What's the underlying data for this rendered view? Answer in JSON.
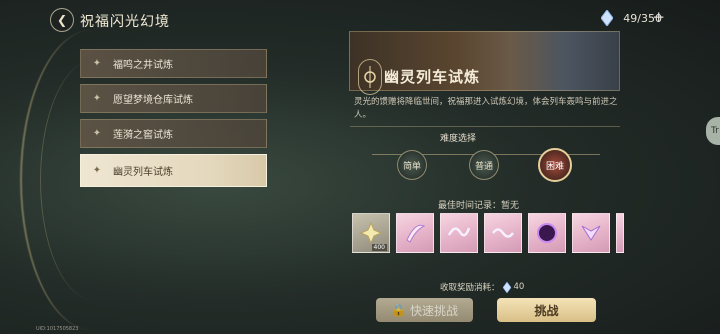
{
  "header": {
    "title": "祝福闪光幻境",
    "currency_value": "49/350",
    "plus": "+"
  },
  "trials": [
    {
      "label": "福鸣之井试炼"
    },
    {
      "label": "愿望梦境仓库试炼"
    },
    {
      "label": "莲漪之窖试炼"
    },
    {
      "label": "幽灵列车试炼",
      "active": true
    }
  ],
  "detail": {
    "title": "幽灵列车试炼",
    "description": "灵光的馈赠将降临世间，祝福那进入试炼幻境，体会列车轰鸣与前进之人。",
    "difficulty_title": "难度选择",
    "difficulties": [
      "简单",
      "普通",
      "困难"
    ],
    "selected_difficulty": "困难",
    "best_time_label": "最佳时间记录：暂无",
    "rewards": [
      {
        "icon": "star-crystal-icon",
        "count": "400"
      },
      {
        "icon": "pink-feather-item-icon"
      },
      {
        "icon": "pink-dragon-item-icon"
      },
      {
        "icon": "pink-wave-item-icon"
      },
      {
        "icon": "purple-orb-item-icon"
      },
      {
        "icon": "pink-wing-item-icon"
      },
      {
        "icon": "partial-item-icon"
      }
    ],
    "cost_label": "收取奖励消耗：",
    "cost_value": "40",
    "quick_button": "快速挑战",
    "challenge_button": "挑战"
  },
  "side_tab": "Tr",
  "uid": "UID:1017505823"
}
